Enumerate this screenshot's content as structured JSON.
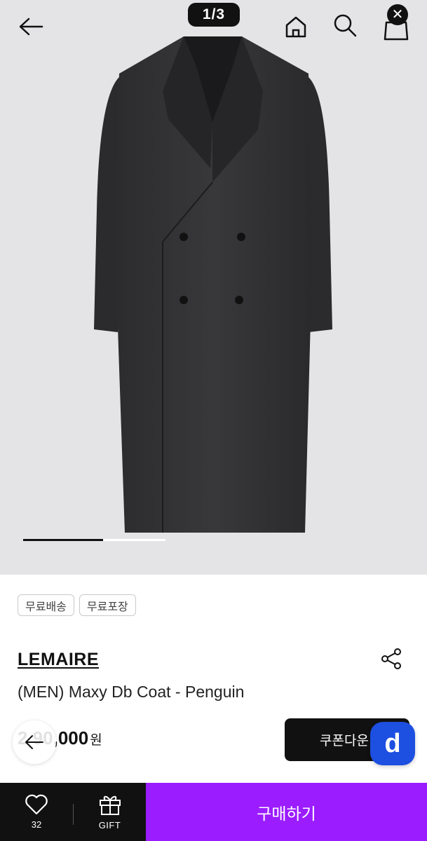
{
  "header": {
    "image_counter": "1/3",
    "icons": [
      "back-arrow-icon",
      "home-icon",
      "search-icon",
      "shopping-bag-icon",
      "close-icon"
    ]
  },
  "gallery": {
    "current_index": 1,
    "total": 3,
    "progress_fraction": 0.56
  },
  "tags": [
    "무료배송",
    "무료포장"
  ],
  "product": {
    "brand": "LEMAIRE",
    "name": "(MEN) Maxy Db Coat - Penguin",
    "price_visible": "2 90,000",
    "price_unit": "원"
  },
  "actions": {
    "coupon_label": "쿠폰다운",
    "app_badge": "d"
  },
  "bottom_bar": {
    "like_count": "32",
    "gift_label": "GIFT",
    "buy_label": "구매하기"
  },
  "colors": {
    "hero_bg": "#e4e4e6",
    "buy_button": "#9b1cff",
    "bottom_bar": "#111111",
    "app_badge": "#1d4fe0"
  }
}
